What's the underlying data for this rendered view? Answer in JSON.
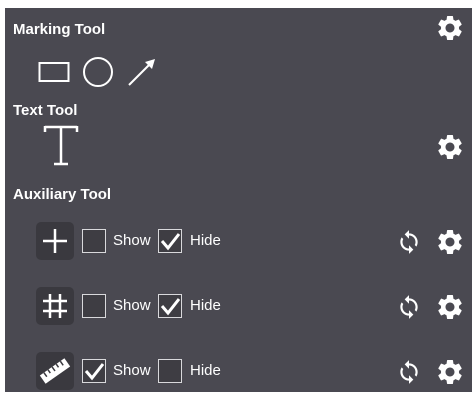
{
  "sections": {
    "marking": {
      "title": "Marking Tool",
      "tools": [
        "rectangle-tool",
        "circle-tool",
        "arrow-tool"
      ]
    },
    "text": {
      "title": "Text Tool",
      "tools": [
        "text-tool"
      ]
    },
    "auxiliary": {
      "title": "Auxiliary Tool",
      "rows": [
        {
          "icon": "crosshair-icon",
          "show_label": "Show",
          "show_checked": false,
          "hide_label": "Hide",
          "hide_checked": true
        },
        {
          "icon": "grid-icon",
          "show_label": "Show",
          "show_checked": false,
          "hide_label": "Hide",
          "hide_checked": true
        },
        {
          "icon": "ruler-icon",
          "show_label": "Show",
          "show_checked": true,
          "hide_label": "Hide",
          "hide_checked": false
        }
      ]
    }
  },
  "colors": {
    "panel_bg": "#4a4951",
    "text": "#ffffff",
    "icon_tile_bg": "#3a393f"
  }
}
